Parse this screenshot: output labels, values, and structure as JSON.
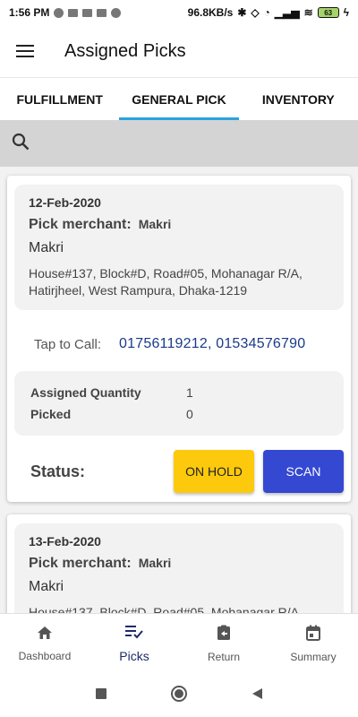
{
  "status_bar": {
    "time": "1:56 PM",
    "network_speed": "96.8KB/s",
    "battery_level": "63"
  },
  "app_bar": {
    "title": "Assigned Picks",
    "menu_icon": "hamburger-menu-icon"
  },
  "tabs": [
    {
      "label": "FULFILLMENT",
      "active": false
    },
    {
      "label": "GENERAL PICK",
      "active": true
    },
    {
      "label": "INVENTORY",
      "active": false
    }
  ],
  "search": {
    "icon": "search-icon"
  },
  "picks": [
    {
      "date": "12-Feb-2020",
      "merchant_label": "Pick merchant:",
      "merchant": "Makri",
      "name": "Makri",
      "address": "House#137, Block#D, Road#05, Mohanagar R/A, Hatirjheel, West Rampura, Dhaka-1219",
      "call_label": "Tap to Call:",
      "phones": "01756119212, 01534576790",
      "assigned_label": "Assigned Quantity",
      "assigned_qty": "1",
      "picked_label": "Picked",
      "picked_qty": "0",
      "status_label": "Status:",
      "hold_label": "ON HOLD",
      "scan_label": "SCAN"
    },
    {
      "date": "13-Feb-2020",
      "merchant_label": "Pick merchant:",
      "merchant": "Makri",
      "name": "Makri",
      "address": "House#137, Block#D, Road#05, Mohanagar R/A"
    }
  ],
  "bottom_nav": [
    {
      "label": "Dashboard",
      "icon": "home-icon",
      "active": false
    },
    {
      "label": "Picks",
      "icon": "picks-checklist-icon",
      "active": true
    },
    {
      "label": "Return",
      "icon": "return-icon",
      "active": false
    },
    {
      "label": "Summary",
      "icon": "calendar-icon",
      "active": false
    }
  ],
  "colors": {
    "tab_indicator": "#29a3dd",
    "hold_button": "#fdc90c",
    "scan_button": "#3548d1",
    "phone_link": "#1a3a8a",
    "active_nav": "#1d2a6b"
  }
}
